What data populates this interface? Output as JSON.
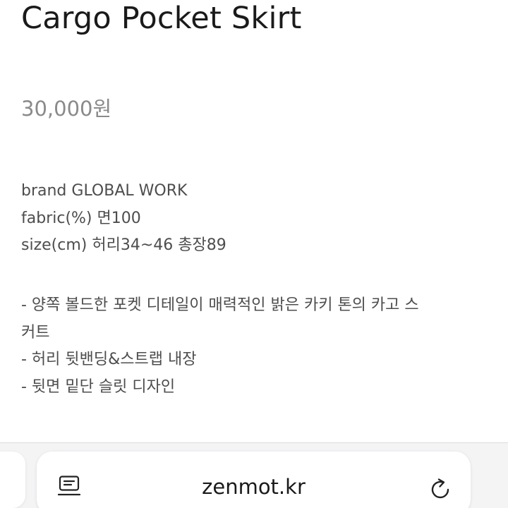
{
  "product": {
    "title": "Cargo Pocket Skirt",
    "price": "30,000원"
  },
  "specs": [
    "brand GLOBAL WORK",
    "fabric(%) 면100",
    "size(cm) 허리34~46 총장89"
  ],
  "description": {
    "bullet1_line1": "- 양쪽 볼드한 포켓 디테일이 매력적인 밝은 카키 톤의 카고 스",
    "bullet1_line2": "커트",
    "bullet2": "- 허리 뒷밴딩&스트랩 내장",
    "bullet3": "- 뒷면 밑단 슬릿 디자인"
  },
  "browser": {
    "url": "zenmot.kr",
    "reader_icon": "reader-mode-icon",
    "reload_icon": "reload-icon"
  },
  "colors": {
    "title": "#1a1a1a",
    "price": "#8a8a8a",
    "body_text": "#4d4d4d",
    "toolbar_bg": "#f4f4f5"
  }
}
